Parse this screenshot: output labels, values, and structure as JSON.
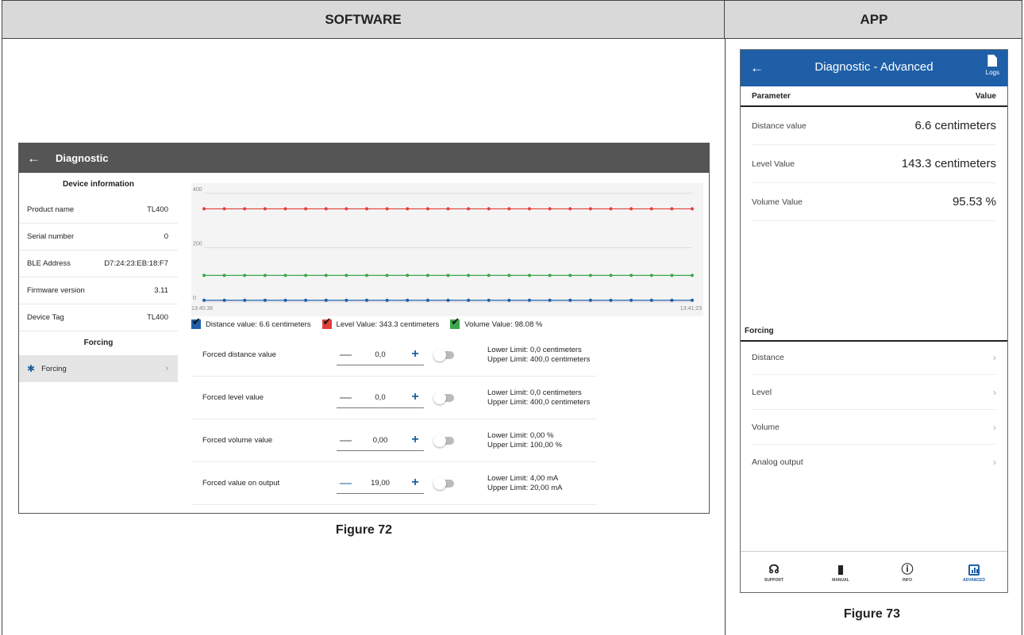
{
  "doc": {
    "software_header": "SOFTWARE",
    "app_header": "APP",
    "figure_sw": "Figure 72",
    "figure_app": "Figure 73"
  },
  "software": {
    "back_icon": "arrow-left-icon",
    "title": "Diagnostic",
    "device_info_title": "Device information",
    "info": [
      {
        "label": "Product name",
        "value": "TL400"
      },
      {
        "label": "Serial number",
        "value": "0"
      },
      {
        "label": "BLE Address",
        "value": "D7:24:23:EB:18:F7"
      },
      {
        "label": "Firmware version",
        "value": "3.11"
      },
      {
        "label": "Device Tag",
        "value": "TL400"
      }
    ],
    "forcing_title": "Forcing",
    "forcing_item": "Forcing",
    "legend": [
      {
        "label": "Distance value: 6.6 centimeters",
        "color": "#1f5fa8"
      },
      {
        "label": "Level Value: 343.3 centimeters",
        "color": "#e0403a"
      },
      {
        "label": "Volume Value: 98.08 %",
        "color": "#3aa84a"
      }
    ],
    "forced": [
      {
        "label": "Forced distance value",
        "value": "0,0",
        "lower": "Lower Limit: 0,0 centimeters",
        "upper": "Upper Limit: 400,0 centimeters"
      },
      {
        "label": "Forced level value",
        "value": "0,0",
        "lower": "Lower Limit: 0,0 centimeters",
        "upper": "Upper Limit: 400,0 centimeters"
      },
      {
        "label": "Forced volume value",
        "value": "0,00",
        "lower": "Lower Limit: 0,00 %",
        "upper": "Upper Limit: 100,00 %"
      },
      {
        "label": "Forced value on output",
        "value": "19,00",
        "lower": "Lower Limit: 4,00 mA",
        "upper": "Upper Limit: 20,00 mA"
      }
    ]
  },
  "chart_data": {
    "type": "line",
    "title": "",
    "xlabel": "",
    "ylabel": "",
    "ylim": [
      0,
      400
    ],
    "y_ticks": [
      "400",
      "200",
      "0"
    ],
    "x_tick_labels": [
      "13:40:36",
      "13:41:23"
    ],
    "grid": true,
    "points_per_series": 25,
    "series": [
      {
        "name": "Distance value",
        "color": "#1f5fa8",
        "values": [
          6.6,
          6.6,
          6.6,
          6.6,
          6.6,
          6.6,
          6.6,
          6.6,
          6.6,
          6.6,
          6.6,
          6.6,
          6.6,
          6.6,
          6.6,
          6.6,
          6.6,
          6.6,
          6.6,
          6.6,
          6.6,
          6.6,
          6.6,
          6.6,
          6.6
        ]
      },
      {
        "name": "Level Value",
        "color": "#e0403a",
        "values": [
          343.3,
          343.3,
          343.3,
          343.3,
          343.3,
          343.3,
          343.3,
          343.3,
          343.3,
          343.3,
          343.3,
          343.3,
          343.3,
          343.3,
          343.3,
          343.3,
          343.3,
          343.3,
          343.3,
          343.3,
          343.3,
          343.3,
          343.3,
          343.3,
          343.3
        ]
      },
      {
        "name": "Volume Value",
        "color": "#3aa84a",
        "values": [
          98.08,
          98.08,
          98.08,
          98.08,
          98.08,
          98.08,
          98.08,
          98.08,
          98.08,
          98.08,
          98.08,
          98.08,
          98.08,
          98.08,
          98.08,
          98.08,
          98.08,
          98.08,
          98.08,
          98.08,
          98.08,
          98.08,
          98.08,
          98.08,
          98.08
        ]
      }
    ]
  },
  "app": {
    "title": "Diagnostic - Advanced",
    "logs_label": "Logs",
    "param_header": "Parameter",
    "value_header": "Value",
    "params": [
      {
        "label": "Distance value",
        "value": "6.6 centimeters"
      },
      {
        "label": "Level Value",
        "value": "143.3 centimeters"
      },
      {
        "label": "Volume Value",
        "value": "95.53 %"
      }
    ],
    "forcing_header": "Forcing",
    "forcing_items": [
      "Distance",
      "Level",
      "Volume",
      "Analog output"
    ],
    "nav": [
      {
        "label": "SUPPORT",
        "icon": "headset-icon"
      },
      {
        "label": "MANUAL",
        "icon": "book-icon"
      },
      {
        "label": "INFO",
        "icon": "info-icon"
      },
      {
        "label": "ADVANCED",
        "icon": "chart-icon"
      }
    ],
    "accent": "#1e5fa8"
  }
}
